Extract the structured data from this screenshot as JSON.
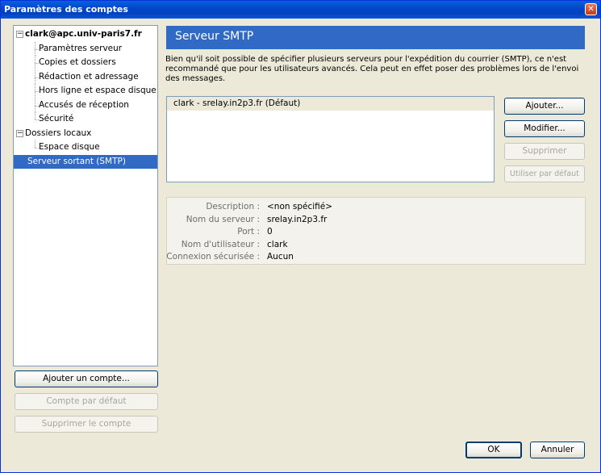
{
  "window": {
    "title": "Paramètres des comptes",
    "close_glyph": "✕"
  },
  "tree": {
    "account": "clark@apc.univ-paris7.fr",
    "account_items": [
      "Paramètres serveur",
      "Copies et dossiers",
      "Rédaction et adressage",
      "Hors ligne et espace disque",
      "Accusés de réception",
      "Sécurité"
    ],
    "local": "Dossiers locaux",
    "local_items": [
      "Espace disque"
    ],
    "smtp": "Serveur sortant (SMTP)"
  },
  "left_buttons": {
    "add_account": "Ajouter un compte...",
    "default_account": "Compte par défaut",
    "delete_account": "Supprimer le compte"
  },
  "panel": {
    "title": "Serveur SMTP",
    "description": "Bien qu'il soit possible de spécifier plusieurs serveurs pour l'expédition du courrier (SMTP), ce n'est recommandé que pour les utilisateurs avancés. Cela peut en effet poser des problèmes lors de l'envoi des messages."
  },
  "servers": [
    "clark - srelay.in2p3.fr (Défaut)"
  ],
  "server_buttons": {
    "add": "Ajouter...",
    "edit": "Modifier...",
    "delete": "Supprimer",
    "set_default": "Utiliser par défaut"
  },
  "details": {
    "description_label": "Description :",
    "description_value": "<non spécifié>",
    "server_label": "Nom du serveur :",
    "server_value": "srelay.in2p3.fr",
    "port_label": "Port :",
    "port_value": "0",
    "user_label": "Nom d'utilisateur :",
    "user_value": "clark",
    "security_label": "Connexion sécurisée :",
    "security_value": "Aucun"
  },
  "footer": {
    "ok": "OK",
    "cancel": "Annuler"
  },
  "colors": {
    "selection": "#316ac5",
    "dialog_bg": "#ece9d8",
    "titlebar": "#0046c8"
  }
}
